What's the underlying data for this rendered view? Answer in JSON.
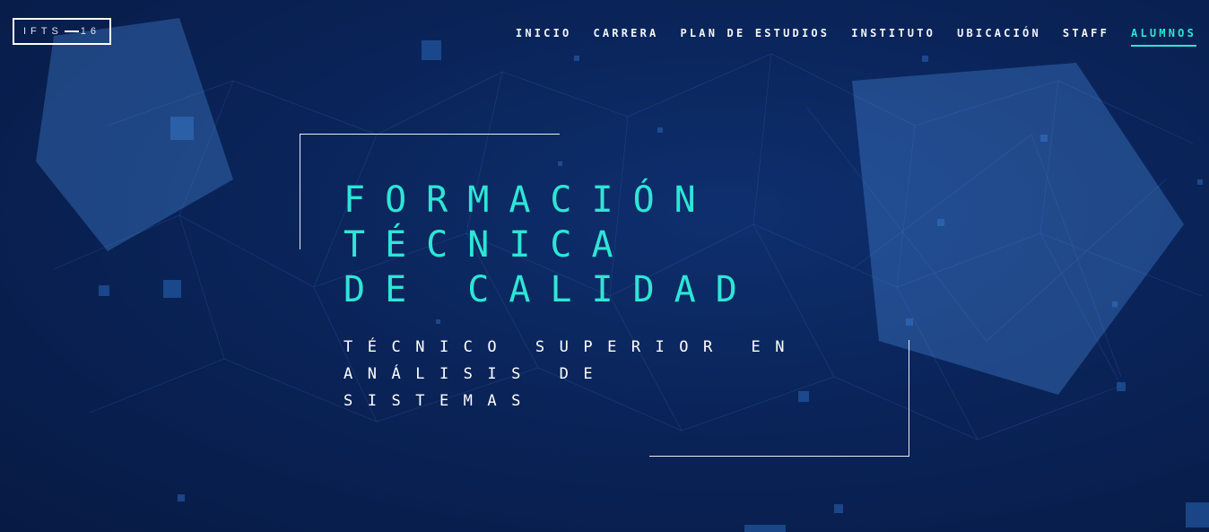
{
  "logo": {
    "left": "IFTS",
    "right": "16"
  },
  "nav": {
    "items": [
      {
        "label": "INICIO"
      },
      {
        "label": "CARRERA"
      },
      {
        "label": "PLAN DE ESTUDIOS"
      },
      {
        "label": "INSTITUTO"
      },
      {
        "label": "UBICACIÓN"
      },
      {
        "label": "STAFF"
      },
      {
        "label": "ALUMNOS"
      }
    ],
    "active_label": "ALUMNOS"
  },
  "hero": {
    "title_lines": [
      "FORMACIÓN",
      "TÉCNICA",
      "DE CALIDAD"
    ],
    "subtitle_lines": [
      "TÉCNICO SUPERIOR EN",
      "ANÁLISIS DE",
      "SISTEMAS"
    ]
  },
  "colors": {
    "accent": "#2de6d6",
    "background": "#0a2459",
    "text": "#ffffff"
  }
}
